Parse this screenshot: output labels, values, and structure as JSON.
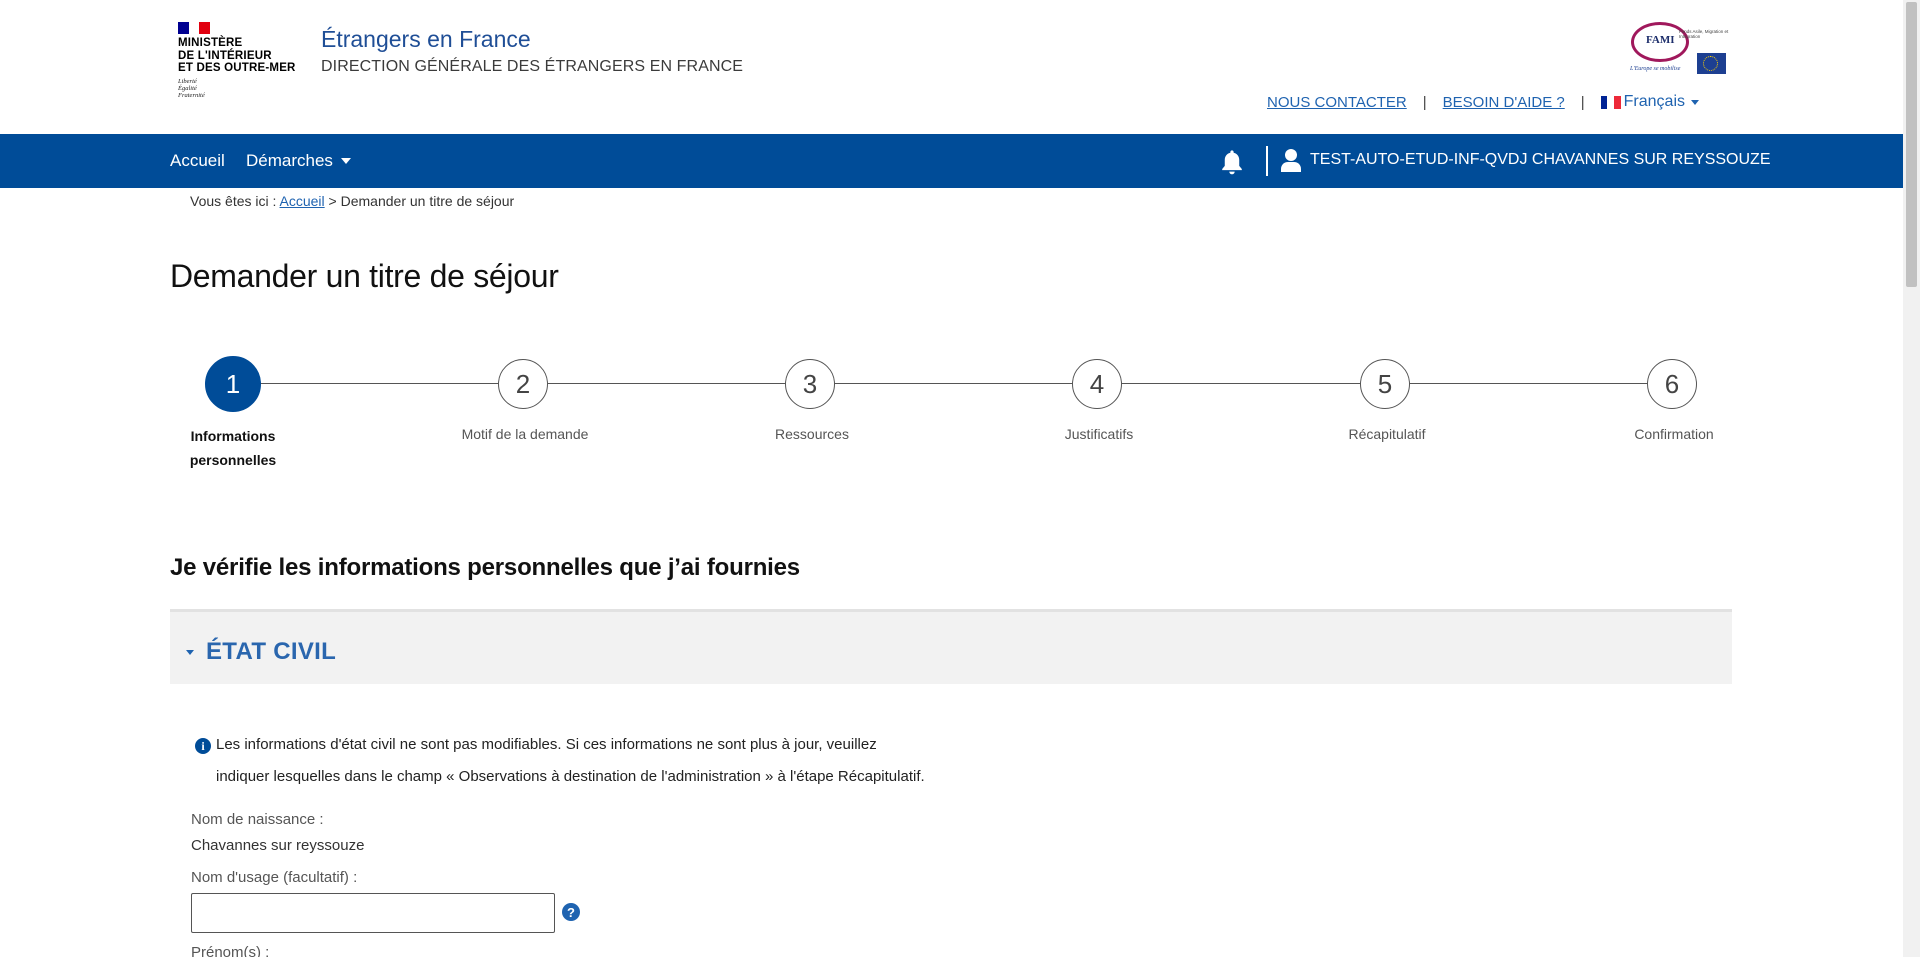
{
  "header": {
    "logo": {
      "flag_colors": [
        "#000091",
        "#ffffff",
        "#e1000f"
      ],
      "title_lines": [
        "MINISTÈRE",
        "DE L'INTÉRIEUR",
        "ET DES OUTRE-MER"
      ],
      "motto": "Liberté\nÉgalité\nFraternité"
    },
    "site_title": "Étrangers en France",
    "site_subtitle": "DIRECTION GÉNÉRALE DES ÉTRANGERS EN FRANCE",
    "fami": {
      "text": "FAMI",
      "small": "Fonds Asile, Migration et Intégration",
      "tagline": "L'Europe se mobilise"
    },
    "links": {
      "contact": "NOUS CONTACTER",
      "help": "BESOIN D'AIDE ?",
      "separator": "|"
    },
    "language": {
      "label": "Français",
      "flag_colors": [
        "#002395",
        "#ffffff",
        "#ed2939"
      ]
    }
  },
  "nav": {
    "home": "Accueil",
    "demarches": "Démarches",
    "bell_icon": "bell-icon",
    "user_icon": "user-icon",
    "user_name": "TEST-AUTO-ETUD-INF-QVDJ CHAVANNES SUR REYSSOUZE",
    "color": "#004c98"
  },
  "breadcrumb": {
    "prefix": "Vous êtes ici :",
    "home": "Accueil",
    "separator": ">",
    "current": "Demander un titre de séjour"
  },
  "page_title": "Demander un titre de séjour",
  "stepper": {
    "current": 1,
    "steps": [
      {
        "number": "1",
        "label_line1": "Informations",
        "label_line2": "personnelles"
      },
      {
        "number": "2",
        "label": "Motif de la demande"
      },
      {
        "number": "3",
        "label": "Ressources"
      },
      {
        "number": "4",
        "label": "Justificatifs"
      },
      {
        "number": "5",
        "label": "Récapitulatif"
      },
      {
        "number": "6",
        "label": "Confirmation"
      }
    ]
  },
  "section_heading": "Je vérifie les informations personnelles que j’ai fournies",
  "accordion": {
    "title": "ÉTAT CIVIL",
    "expanded": true
  },
  "info": {
    "icon": "info-icon",
    "line1": "Les informations d'état civil ne sont pas modifiables. Si ces informations ne sont plus à jour, veuillez",
    "line2": "indiquer lesquelles dans le champ « Observations à destination de l'administration » à l'étape Récapitulatif."
  },
  "fields": {
    "birth_name_label": "Nom de naissance :",
    "birth_name_value": "Chavannes sur reyssouze",
    "usage_name_label": "Nom d'usage (facultatif) :",
    "usage_name_value": "",
    "help_icon": "help-icon",
    "first_names_label": "Prénom(s) :"
  }
}
